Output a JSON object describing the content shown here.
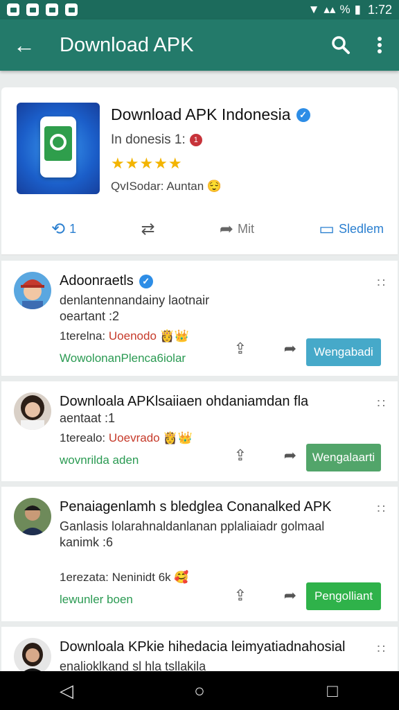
{
  "status_bar": {
    "time": "1:72",
    "signal_text": "%"
  },
  "app_bar": {
    "title": "Download APK"
  },
  "app_card": {
    "title": "Download APK Indonesia",
    "subtitle": "In donesis 1:",
    "subtitle_badge": "1",
    "stars": "★★★★★",
    "meta": "QvISodar: Auntan 😌",
    "actions": [
      {
        "icon": "⟲",
        "label": "1"
      },
      {
        "icon": "⇄",
        "label": ""
      },
      {
        "icon": "➦",
        "label": "Mit"
      },
      {
        "icon": "▭",
        "label": "Sledlem"
      }
    ]
  },
  "posts": [
    {
      "name": "Adoonraetls",
      "verified": true,
      "lines": [
        "denlantennandainy laotnair",
        "oeartant :2"
      ],
      "meta_prefix": "1terelna: ",
      "meta_red": "Uoenodo",
      "meta_emoji": "👸👑",
      "green": "WowolonanPlenca6iolar",
      "button": "Wengabadi",
      "button_color": "#46a9c9"
    },
    {
      "name": "Downloala APKlsaiiaen ohdaniamdan fla",
      "verified": false,
      "lines": [
        "aentaat :1"
      ],
      "meta_prefix": "1terealo: ",
      "meta_red": "Uoevrado",
      "meta_emoji": "👸👑",
      "green": "wovnrilda aden",
      "button": "Wengalaarti",
      "button_color": "#52a56a"
    },
    {
      "name": "Penaiagenlamh s bledglea Conanalked APK",
      "verified": false,
      "lines": [
        "Ganlasis lolarahnaldanlanan pplaliaiadr golmaal",
        "kanimk :6"
      ],
      "meta_prefix": "1erezata: ",
      "meta_red": "",
      "meta_plain": "Neninidt 6k",
      "meta_emoji": "🥰",
      "green": "lewunler boen",
      "button": "Pengolliant",
      "button_color": "#2fb24a"
    },
    {
      "name": "Downloala KPkie hihedacia leimyatiadnahosial",
      "verified": false,
      "lines": [
        "enalioklkand sl hla tsllakila"
      ],
      "meta_prefix": "",
      "meta_red": "",
      "meta_emoji": "",
      "green": "",
      "button": "",
      "button_color": "#2fb24a"
    }
  ],
  "nav": {
    "back": "◁",
    "home": "○",
    "recent": "□"
  }
}
